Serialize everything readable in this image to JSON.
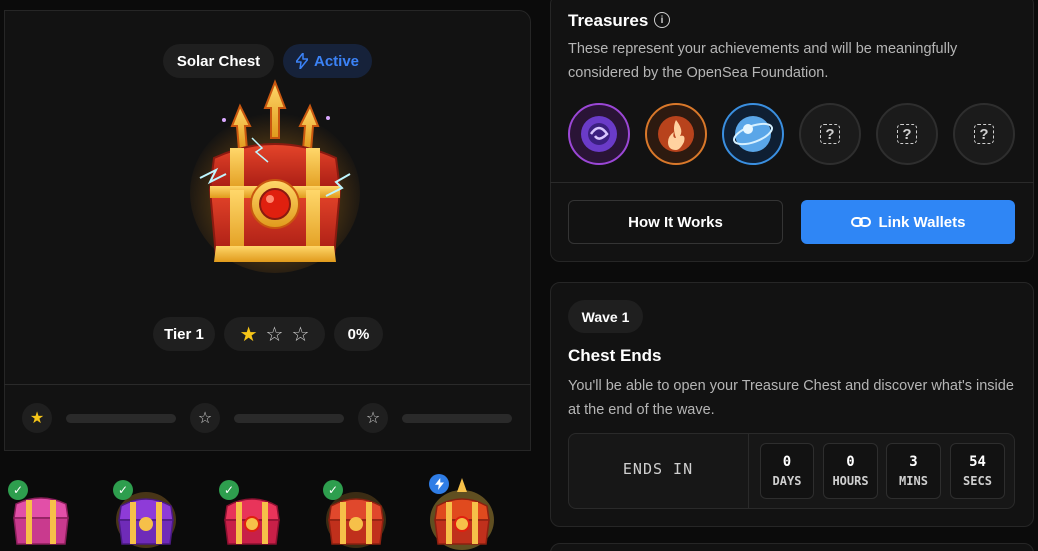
{
  "chest": {
    "name": "Solar Chest",
    "status": "Active",
    "tier": "Tier 1",
    "progress": "0%",
    "stars_filled": 1,
    "stars_total": 3
  },
  "progress_track": {
    "stars": [
      "filled",
      "empty",
      "empty"
    ],
    "bar_fill": [
      0,
      0,
      0
    ]
  },
  "chest_history": [
    {
      "badge": "check",
      "color": "#e24fa8"
    },
    {
      "badge": "check",
      "color": "#8e3bd8"
    },
    {
      "badge": "check",
      "color": "#e8345a"
    },
    {
      "badge": "check",
      "color": "#e0482c"
    },
    {
      "badge": "bolt",
      "color": "#e04a1e"
    }
  ],
  "treasures": {
    "title": "Treasures",
    "description": "These represent your achievements and will be meaningfully considered by the OpenSea Foundation.",
    "orbs": [
      {
        "state": "earned",
        "kind": "amethyst",
        "ring": "#9b47d6"
      },
      {
        "state": "earned",
        "kind": "fire",
        "ring": "#d9782a"
      },
      {
        "state": "earned",
        "kind": "ice",
        "ring": "#3a8fe0"
      },
      {
        "state": "locked",
        "symbol": "?"
      },
      {
        "state": "locked",
        "symbol": "?"
      },
      {
        "state": "locked",
        "symbol": "?"
      }
    ],
    "how_it_works_label": "How It Works",
    "link_wallets_label": "Link Wallets"
  },
  "wave": {
    "label": "Wave 1",
    "title": "Chest Ends",
    "description": "You'll be able to open your Treasure Chest and discover what's inside at the end of the wave.",
    "ends_in_label": "ENDS IN",
    "countdown": [
      {
        "value": "0",
        "unit": "DAYS"
      },
      {
        "value": "0",
        "unit": "HOURS"
      },
      {
        "value": "3",
        "unit": "MINS"
      },
      {
        "value": "54",
        "unit": "SECS"
      }
    ]
  },
  "colors": {
    "accent_blue": "#2f86f5",
    "active_blue": "#3b82f6",
    "star_gold": "#f5c518",
    "check_green": "#2e9e4e"
  }
}
